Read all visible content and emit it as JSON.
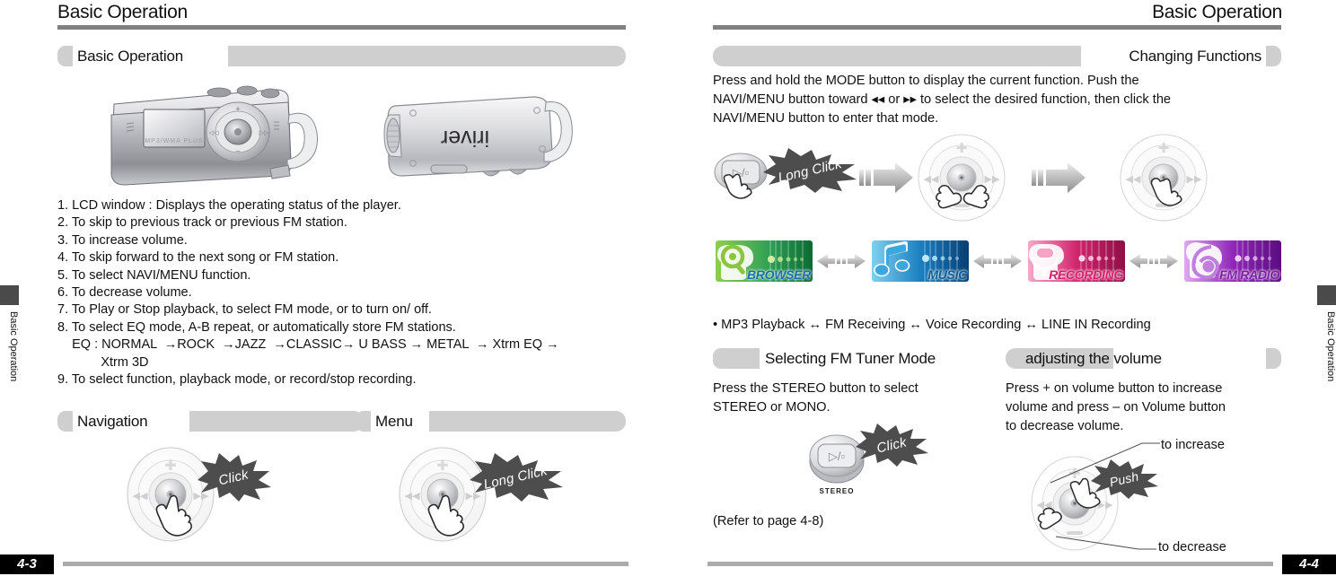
{
  "doc": {
    "left_page": {
      "running_head": "Basic Operation",
      "side_tab": "Basic Operation",
      "page_number": "4-3",
      "sections": [
        {
          "title": "Basic Operation"
        },
        {
          "title": "Navigation"
        },
        {
          "title": "Menu"
        }
      ],
      "device_labels": {
        "front_lcd_text": "MP3/WMA PLUS",
        "side_brand": "iriver"
      },
      "numbered_list": [
        "1. LCD window : Displays the operating status of the player.",
        "2. To skip to previous track or previous FM station.",
        "3. To increase volume.",
        "4. To skip forward to the next song or FM station.",
        "5. To select NAVI/MENU function.",
        "6. To decrease volume.",
        "7. To Play or Stop playback, to select FM mode, or to turn on/ off.",
        "8. To select EQ mode, A-B repeat, or automatically store FM stations.",
        "    EQ : NORMAL  →ROCK  →JAZZ  →CLASSIC→ U BASS → METAL  → Xtrm EQ →",
        "            Xtrm 3D",
        "9. To select function, playback mode, or record/stop recording."
      ],
      "navigation_burst": "Click",
      "menu_burst": "Long Click"
    },
    "right_page": {
      "running_head": "Basic Operation",
      "side_tab": "Basic Operation",
      "page_number": "4-4",
      "changing_functions": {
        "title": "Changing Functions",
        "paragraph_lines": [
          "Press and hold the MODE button to display the current function. Push the",
          "NAVI/MENU button toward  ◂◂  or  ▸▸ to select the desired function, then click the",
          "NAVI/MENU button to enter that mode."
        ],
        "step_burst": "Long Click",
        "function_tiles": [
          {
            "label": "BROWSER",
            "icon": "browser-icon",
            "bg_from": "#7dc242",
            "bg_to": "#0d7a3c",
            "text_color": "#1b6fa8"
          },
          {
            "label": "MUSIC",
            "icon": "music-note-icon",
            "bg_from": "#63c7e8",
            "bg_to": "#0b4f8a",
            "text_color": "#0d5c93"
          },
          {
            "label": "RECORDING",
            "icon": "microphone-icon",
            "bg_from": "#f29ec4",
            "bg_to": "#c2185b",
            "text_color": "#d8216b"
          },
          {
            "label": "FM RADIO",
            "icon": "fm-radio-icon",
            "bg_from": "#cf8fe0",
            "bg_to": "#6a1b9a",
            "text_color": "#7b1fa2"
          }
        ],
        "flow_text": "• MP3 Playback  ↔ FM Receiving  ↔ Voice Recording  ↔ LINE IN Recording"
      },
      "fm_tuner": {
        "title": "Selecting FM Tuner Mode",
        "paragraph_lines": [
          "Press the STEREO button to select",
          "STEREO or MONO."
        ],
        "button_caption": "STEREO",
        "burst": "Click",
        "footnote": "(Refer to page 4-8)"
      },
      "volume": {
        "title": "adjusting the volume",
        "paragraph_lines": [
          "Press + on volume button to increase",
          "volume and press – on Volume button",
          "to decrease volume."
        ],
        "burst": "Push",
        "callout_increase": "to increase",
        "callout_decrease": "to decrease"
      }
    }
  },
  "colors": {
    "rule_gray": "#808080",
    "pill_gray": "#cfcfcf",
    "tab_dark": "#4a4a4a",
    "footer_bar": "#aaaaaa",
    "burst_fill": "#4d4d4d"
  }
}
